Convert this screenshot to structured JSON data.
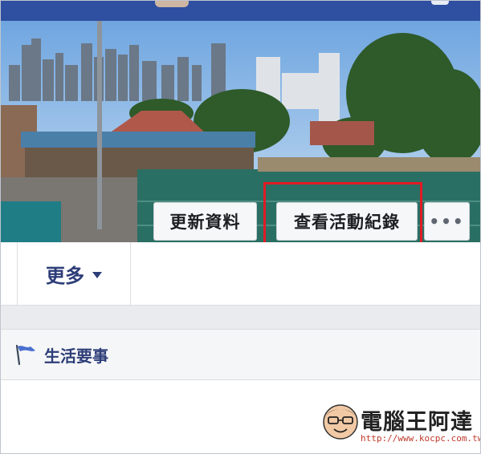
{
  "profile_actions": {
    "update_info_label": "更新資料",
    "view_activity_log_label": "查看活動紀錄",
    "more_options_label": "•••"
  },
  "tabs": {
    "more_label": "更多"
  },
  "sections": {
    "life_events_label": "生活要事"
  },
  "watermark": {
    "title": "電腦王阿達",
    "url": "http://www.kocpc.com.tw"
  },
  "colors": {
    "topbar": "#2f4fa0",
    "highlight": "#e01b24",
    "tab_text": "#2d3d78"
  },
  "icons": {
    "more_caret": "caret-down-icon",
    "life_events": "flag-icon"
  }
}
